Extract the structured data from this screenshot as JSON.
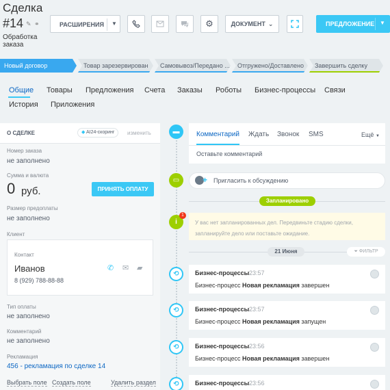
{
  "header": {
    "title": "Сделка",
    "deal_number": "#14",
    "stage_label": "Обработка заказа",
    "extensions_label": "РАСШИРЕНИЯ",
    "document_label": "ДОКУМЕНТ",
    "offer_label": "ПРЕДЛОЖЕНИЕ"
  },
  "stages": [
    {
      "label": "Новый договор"
    },
    {
      "label": "Товар зарезервирован"
    },
    {
      "label": "Самовывоз/Передано ..."
    },
    {
      "label": "Отгружено/Доставлено"
    },
    {
      "label": "Завершить сделку"
    }
  ],
  "tabs": [
    {
      "label": "Общие"
    },
    {
      "label": "Товары"
    },
    {
      "label": "Предложения"
    },
    {
      "label": "Счета"
    },
    {
      "label": "Заказы"
    },
    {
      "label": "Роботы"
    },
    {
      "label": "Бизнес-процессы"
    },
    {
      "label": "Связи"
    },
    {
      "label": "История"
    },
    {
      "label": "Приложения"
    }
  ],
  "about": {
    "title": "О СДЕЛКЕ",
    "ai_scoring": "AI24-скоринг",
    "edit": "изменить",
    "order_number_label": "Номер заказа",
    "order_number_value": "не заполнено",
    "amount_label": "Сумма и валюта",
    "amount_value": "0",
    "currency": "руб.",
    "pay_button": "ПРИНЯТЬ ОПЛАТУ",
    "prepay_label": "Размер предоплаты",
    "prepay_value": "не заполнено",
    "client_label": "Клиент",
    "contact_label": "Контакт",
    "contact_name": "Иванов",
    "contact_phone": "8 (929) 788-88-88",
    "payment_type_label": "Тип оплаты",
    "payment_type_value": "не заполнено",
    "comment_label": "Комментарий",
    "comment_value": "не заполнено",
    "claim_label": "Рекламация",
    "claim_value": "456 - рекламация по сделке 14",
    "select_field": "Выбрать поле",
    "create_field": "Создать поле",
    "delete_section": "Удалить раздел"
  },
  "composer": {
    "tabs": [
      "Комментарий",
      "Ждать",
      "Звонок",
      "SMS"
    ],
    "more": "Ещё",
    "placeholder": "Оставьте комментарий"
  },
  "timeline": {
    "invite": "Пригласить к обсуждению",
    "planned": "Запланировано",
    "notice": "У вас нет запланированных дел. Передвиньте стадию сделки, запланируйте дело или поставьте ожидание.",
    "notice_count": "1",
    "date": "21 Июня",
    "filter": "ФИЛЬТР",
    "items": [
      {
        "title": "Бизнес-процессы",
        "time": "23:57",
        "prefix": "Бизнес-процесс",
        "name": "Новая рекламация",
        "status": "завершен"
      },
      {
        "title": "Бизнес-процессы",
        "time": "23:57",
        "prefix": "Бизнес-процесс",
        "name": "Новая рекламация",
        "status": "запущен"
      },
      {
        "title": "Бизнес-процессы",
        "time": "23:56",
        "prefix": "Бизнес-процесс",
        "name": "Новая рекламация",
        "status": "завершен"
      },
      {
        "title": "Бизнес-процессы",
        "time": "23:56",
        "prefix": "",
        "name": "",
        "status": ""
      }
    ]
  },
  "colors": {
    "accent": "#3bc8f5",
    "stage_active": "#39a8ef",
    "link": "#0b66c3",
    "green": "#9dcf00"
  }
}
